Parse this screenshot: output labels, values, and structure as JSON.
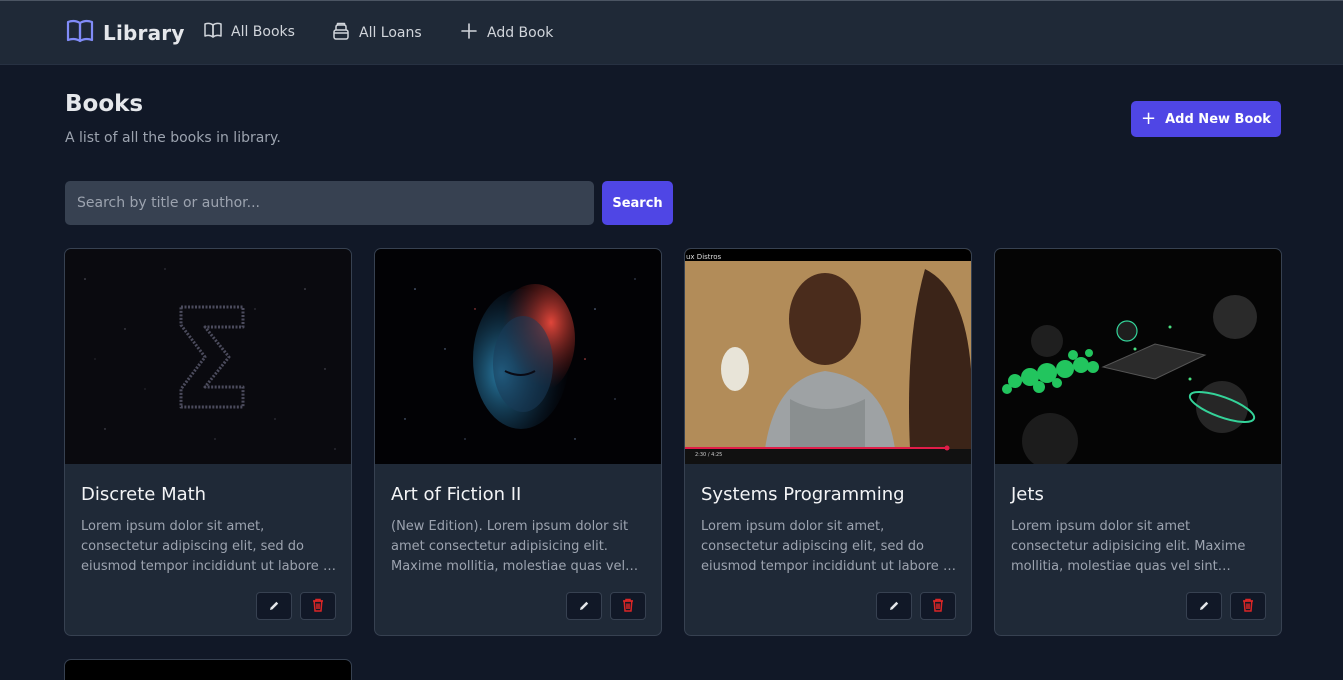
{
  "navbar": {
    "brand": "Library",
    "links": [
      {
        "label": "All Books",
        "icon": "book-open-icon"
      },
      {
        "label": "All Loans",
        "icon": "archive-icon"
      },
      {
        "label": "Add Book",
        "icon": "plus-icon"
      }
    ]
  },
  "header": {
    "title": "Books",
    "subtitle": "A list of all the books in library.",
    "add_button": "Add New Book"
  },
  "search": {
    "placeholder": "Search by title or author...",
    "value": "",
    "button": "Search"
  },
  "books": [
    {
      "title": "Discrete Math",
      "description": "Lorem ipsum dolor sit amet, consectetur adipiscing elit, sed do eiusmod tempor incididunt ut labore et dolore magna aliqua."
    },
    {
      "title": "Art of Fiction II",
      "description": "(New Edition). Lorem ipsum dolor sit amet consectetur adipisicing elit. Maxime mollitia, molestiae quas vel sint commodi."
    },
    {
      "title": "Systems Programming",
      "description": "Lorem ipsum dolor sit amet, consectetur adipiscing elit, sed do eiusmod tempor incididunt ut labore et dolore magna aliqua.",
      "image_overlay": {
        "corner_text": "ux Distros",
        "timestamp": "2:30 / 4:25"
      }
    },
    {
      "title": "Jets",
      "description": "Lorem ipsum dolor sit amet consectetur adipisicing elit. Maxime mollitia, molestiae quas vel sint commodi repudiandae."
    }
  ],
  "colors": {
    "accent": "#4f46e5",
    "background": "#111827",
    "surface": "#1f2937",
    "danger": "#dc2626"
  }
}
